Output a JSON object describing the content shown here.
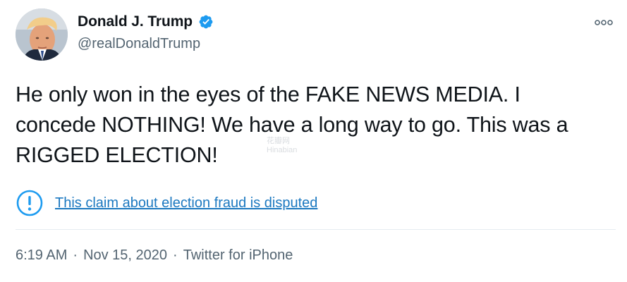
{
  "author": {
    "name": "Donald J. Trump",
    "handle": "@realDonaldTrump",
    "verified": true,
    "avatar_icon": "profile-photo",
    "verified_icon": "verified-badge-icon"
  },
  "menu": {
    "icon": "more-options-icon"
  },
  "tweet": {
    "text": "He only won in the eyes of the FAKE NEWS MEDIA. I\nconcede NOTHING! We have a long way to go. This was a\nRIGGED ELECTION!"
  },
  "notice": {
    "icon": "exclamation-circle-icon",
    "text": "This claim about election fraud is disputed"
  },
  "meta": {
    "time": "6:19 AM",
    "separator": "·",
    "date": "Nov 15, 2020",
    "source": "Twitter for iPhone"
  },
  "watermark": {
    "line1": "花瓣网",
    "line2": "Hinabian"
  },
  "colors": {
    "brand_blue": "#1d9bf0",
    "link_blue": "#1b78c0",
    "text": "#0f1419",
    "secondary": "#536471",
    "divider": "#e6ecf0"
  }
}
